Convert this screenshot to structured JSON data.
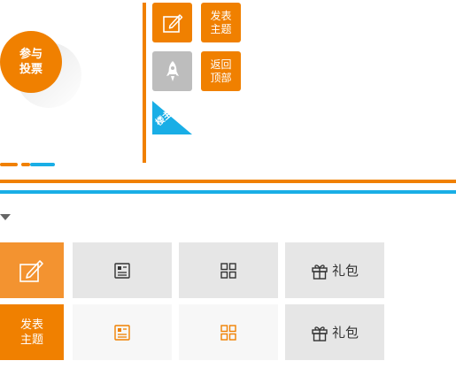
{
  "vote_button": {
    "label": "参与 投票",
    "icon": "circle-badge"
  },
  "side_tools": {
    "edit_icon": "edit-icon",
    "post_topic_label": "发表 主题",
    "rocket_icon": "rocket-icon",
    "back_to_top_label": "返回 顶部",
    "owner_tag": "楼主"
  },
  "colors": {
    "orange": "#f08000",
    "light_orange": "#f39330",
    "blue": "#19aee6",
    "grey": "#bdbdbd",
    "panel": "#e6e6e6"
  },
  "grid": {
    "row1": {
      "side_icon": "edit-icon",
      "list_icon": "list-icon",
      "grid_icon": "grid-icon",
      "gift_label": "礼包"
    },
    "row2": {
      "side_label": "发表 主题",
      "list_icon": "list-icon",
      "grid_icon": "grid-icon",
      "gift_label": "礼包"
    }
  }
}
